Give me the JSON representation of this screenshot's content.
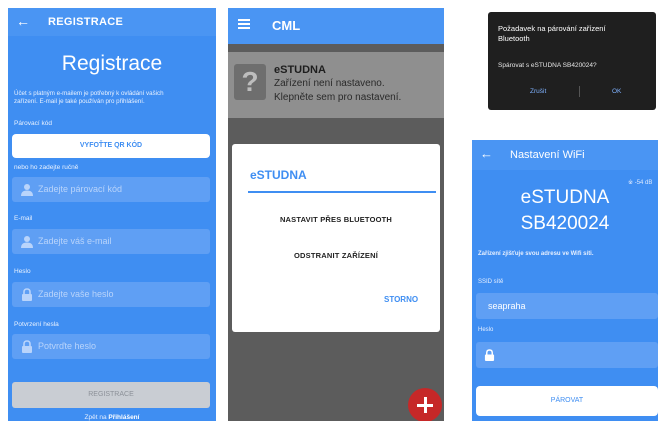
{
  "registration": {
    "back_icon": "arrow-left-icon",
    "header_title": "REGISTRACE",
    "title": "Registrace",
    "info_line1": "Účet s platným e-mailem je potřebný k ovládání vašich",
    "info_line2": "zařízení. E-mail je také používán pro přihlášení.",
    "pairing_code_label": "Párovací kód",
    "qr_button": "VYFOŤTE QR KÓD",
    "manual_label": "nebo ho zadejte ručně",
    "pairing_code_placeholder": "Zadejte párovací kód",
    "email_label": "E-mail",
    "email_placeholder": "Zadejte váš e-mail",
    "password_label": "Heslo",
    "password_placeholder": "Zadejte vaše heslo",
    "password_confirm_label": "Potvrzení hesla",
    "password_confirm_placeholder": "Potvrďte heslo",
    "register_button": "REGISTRACE",
    "footer_text": "Zpět na",
    "footer_link": "Přihlášení"
  },
  "cml": {
    "menu_icon": "hamburger-menu-icon",
    "header_title": "CML",
    "device_icon": "question-mark-icon",
    "device_name": "eSTUDNA",
    "device_status_line1": "Zařízení není nastaveno.",
    "device_status_line2": "Klepněte sem pro nastavení.",
    "dialog_title": "eSTUDNA",
    "option_bluetooth": "NASTAVIT PŘES BLUETOOTH",
    "option_remove": "ODSTRANIT ZAŘÍZENÍ",
    "cancel_button": "STORNO",
    "fab_icon": "plus-icon"
  },
  "bt_dialog": {
    "title_line1": "Požadavek na párování zařízení",
    "title_line2": "Bluetooth",
    "message": "Spárovat s eSTUDNA SB420024?",
    "cancel_button": "Zrušit",
    "ok_button": "OK"
  },
  "wifi": {
    "back_icon": "arrow-left-icon",
    "header_title": "Nastavení WiFi",
    "signal": "-54 dB",
    "bluetooth_icon": "bluetooth-icon",
    "device_name_line1": "eSTUDNA",
    "device_name_line2": "SB420024",
    "status_text": "Zařízení zjišťuje svou adresu ve Wifi síti.",
    "ssid_label": "SSID sítě",
    "ssid_value": "seapraha",
    "password_label": "Heslo",
    "pair_button": "PÁROVAT"
  },
  "colors": {
    "primary_blue": "#3f8ef2",
    "fab_red": "#c62828",
    "dialog_dark": "#1f1f1f"
  }
}
